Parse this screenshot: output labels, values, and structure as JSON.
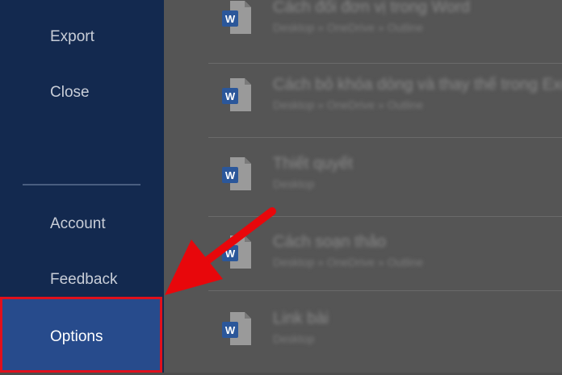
{
  "sidebar": {
    "items": [
      {
        "label": "Export"
      },
      {
        "label": "Close"
      },
      {
        "label": "Account"
      },
      {
        "label": "Feedback"
      },
      {
        "label": "Options"
      }
    ],
    "selected": "Options"
  },
  "recent_documents": [
    {
      "title": "Cách đổi đơn vị trong Word",
      "location": "Desktop » OneDrive » Outline"
    },
    {
      "title": "Cách bỏ khóa dòng và thay thế trong Excel",
      "location": "Desktop » OneDrive » Outline"
    },
    {
      "title": "Thiết quyết",
      "location": "Desktop"
    },
    {
      "title": "Cách soạn thảo",
      "location": "Desktop » OneDrive » Outline"
    },
    {
      "title": "Link bài",
      "location": "Desktop"
    }
  ],
  "colors": {
    "sidebar": "#13294f",
    "selected": "#274b8c",
    "highlight_border": "#e0101c",
    "arrow": "#e8070b",
    "word_icon": "#2b579a"
  }
}
